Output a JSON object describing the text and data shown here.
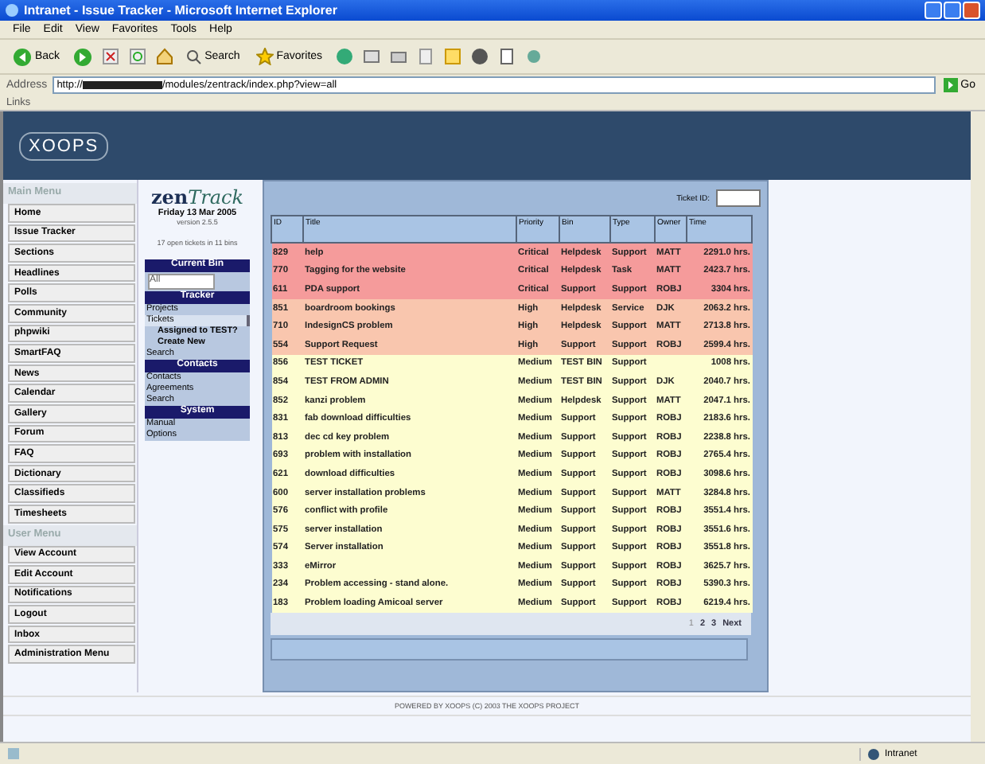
{
  "window": {
    "title": "Intranet - Issue Tracker - Microsoft Internet Explorer"
  },
  "menu_bar": [
    "File",
    "Edit",
    "View",
    "Favorites",
    "Tools",
    "Help"
  ],
  "toolbar": {
    "back": "Back",
    "search": "Search",
    "favorites": "Favorites"
  },
  "address_bar": {
    "label": "Address",
    "url_start": "http://",
    "url_end": "/modules/zentrack/index.php?view=all",
    "go": "Go"
  },
  "links_bar": "Links",
  "site_logo": "XOOPS",
  "main_menu": {
    "title": "Main Menu",
    "items": [
      "Home",
      "Issue Tracker",
      "Sections",
      "Headlines",
      "Polls",
      "Community",
      "phpwiki",
      "SmartFAQ",
      "News",
      "Calendar",
      "Gallery",
      "Forum",
      "FAQ",
      "Dictionary",
      "Classifieds",
      "Timesheets"
    ]
  },
  "user_menu": {
    "title": "User Menu",
    "items": [
      "View Account",
      "Edit Account",
      "Notifications",
      "Logout",
      "Inbox",
      "Administration Menu"
    ]
  },
  "zentrack": {
    "logo_left": "zen",
    "logo_right": "Track",
    "date": "Friday 13 Mar 2005",
    "version": "version 2.5.5",
    "summary": "17 open tickets in 11 bins",
    "sections": [
      {
        "title": "Current Bin",
        "select": "All"
      },
      {
        "title": "Tracker",
        "links": [
          {
            "label": "Projects",
            "selected": false,
            "sub": false
          },
          {
            "label": "Tickets",
            "selected": true,
            "sub": false
          },
          {
            "label": "Assigned to TEST?",
            "selected": false,
            "sub": true
          },
          {
            "label": "Create New",
            "selected": false,
            "sub": true
          },
          {
            "label": "Search",
            "selected": false,
            "sub": false
          }
        ]
      },
      {
        "title": "Contacts",
        "links": [
          {
            "label": "Contacts",
            "selected": false,
            "sub": false
          },
          {
            "label": "Agreements",
            "selected": false,
            "sub": false
          },
          {
            "label": "Search",
            "selected": false,
            "sub": false
          }
        ]
      },
      {
        "title": "System",
        "links": [
          {
            "label": "Manual",
            "selected": false,
            "sub": false
          },
          {
            "label": "Options",
            "selected": false,
            "sub": false
          }
        ]
      }
    ]
  },
  "tickets": {
    "ticket_id_label": "Ticket ID:",
    "columns": [
      "ID",
      "Title",
      "Priority",
      "Bin",
      "Type",
      "Owner",
      "Time"
    ],
    "rows": [
      {
        "id": "829",
        "title": "help",
        "priority": "Critical",
        "bin": "Helpdesk",
        "type": "Support",
        "owner": "MATT",
        "time": "2291.0 hrs.",
        "color": "#f59b9b"
      },
      {
        "id": "770",
        "title": "Tagging for the website",
        "priority": "Critical",
        "bin": "Helpdesk",
        "type": "Task",
        "owner": "MATT",
        "time": "2423.7 hrs.",
        "color": "#f59b9b"
      },
      {
        "id": "611",
        "title": "PDA support",
        "priority": "Critical",
        "bin": "Support",
        "type": "Support",
        "owner": "ROBJ",
        "time": "3304 hrs.",
        "color": "#f59b9b"
      },
      {
        "id": "851",
        "title": "boardroom bookings",
        "priority": "High",
        "bin": "Helpdesk",
        "type": "Service",
        "owner": "DJK",
        "time": "2063.2 hrs.",
        "color": "#f9c6ae"
      },
      {
        "id": "710",
        "title": "IndesignCS problem",
        "priority": "High",
        "bin": "Helpdesk",
        "type": "Support",
        "owner": "MATT",
        "time": "2713.8 hrs.",
        "color": "#f9c6ae"
      },
      {
        "id": "554",
        "title": "Support Request",
        "priority": "High",
        "bin": "Support",
        "type": "Support",
        "owner": "ROBJ",
        "time": "2599.4 hrs.",
        "color": "#f9c6ae"
      },
      {
        "id": "856",
        "title": "TEST TICKET",
        "priority": "Medium",
        "bin": "TEST BIN",
        "type": "Support",
        "owner": "",
        "time": "1008 hrs.",
        "color": "#fdfdd0"
      },
      {
        "id": "854",
        "title": "TEST FROM ADMIN",
        "priority": "Medium",
        "bin": "TEST BIN",
        "type": "Support",
        "owner": "DJK",
        "time": "2040.7 hrs.",
        "color": "#fdfdd0"
      },
      {
        "id": "852",
        "title": "kanzi problem",
        "priority": "Medium",
        "bin": "Helpdesk",
        "type": "Support",
        "owner": "MATT",
        "time": "2047.1 hrs.",
        "color": "#fdfdd0"
      },
      {
        "id": "831",
        "title": "fab download difficulties",
        "priority": "Medium",
        "bin": "Support",
        "type": "Support",
        "owner": "ROBJ",
        "time": "2183.6 hrs.",
        "color": "#fdfdd0"
      },
      {
        "id": "813",
        "title": "dec cd key problem",
        "priority": "Medium",
        "bin": "Support",
        "type": "Support",
        "owner": "ROBJ",
        "time": "2238.8 hrs.",
        "color": "#fdfdd0"
      },
      {
        "id": "693",
        "title": "problem with installation",
        "priority": "Medium",
        "bin": "Support",
        "type": "Support",
        "owner": "ROBJ",
        "time": "2765.4 hrs.",
        "color": "#fdfdd0"
      },
      {
        "id": "621",
        "title": "download difficulties",
        "priority": "Medium",
        "bin": "Support",
        "type": "Support",
        "owner": "ROBJ",
        "time": "3098.6 hrs.",
        "color": "#fdfdd0"
      },
      {
        "id": "600",
        "title": "server installation problems",
        "priority": "Medium",
        "bin": "Support",
        "type": "Support",
        "owner": "MATT",
        "time": "3284.8 hrs.",
        "color": "#fdfdd0"
      },
      {
        "id": "576",
        "title": "conflict with profile",
        "priority": "Medium",
        "bin": "Support",
        "type": "Support",
        "owner": "ROBJ",
        "time": "3551.4 hrs.",
        "color": "#fdfdd0"
      },
      {
        "id": "575",
        "title": "server installation",
        "priority": "Medium",
        "bin": "Support",
        "type": "Support",
        "owner": "ROBJ",
        "time": "3551.6 hrs.",
        "color": "#fdfdd0"
      },
      {
        "id": "574",
        "title": "Server installation",
        "priority": "Medium",
        "bin": "Support",
        "type": "Support",
        "owner": "ROBJ",
        "time": "3551.8 hrs.",
        "color": "#fdfdd0"
      },
      {
        "id": "333",
        "title": "eMirror",
        "priority": "Medium",
        "bin": "Support",
        "type": "Support",
        "owner": "ROBJ",
        "time": "3625.7 hrs.",
        "color": "#fdfdd0"
      },
      {
        "id": "234",
        "title": "Problem accessing - stand alone.",
        "priority": "Medium",
        "bin": "Support",
        "type": "Support",
        "owner": "ROBJ",
        "time": "5390.3 hrs.",
        "color": "#fdfdd0"
      },
      {
        "id": "183",
        "title": "Problem loading Amicoal server",
        "priority": "Medium",
        "bin": "Support",
        "type": "Support",
        "owner": "ROBJ",
        "time": "6219.4 hrs.",
        "color": "#fdfdd0"
      }
    ],
    "pages": [
      {
        "label": "1",
        "selected": true
      },
      {
        "label": "2",
        "selected": false
      },
      {
        "label": "3",
        "selected": false
      },
      {
        "label": "Next",
        "selected": false
      }
    ]
  },
  "footer": "POWERED BY XOOPS (C) 2003 THE XOOPS PROJECT",
  "status_bar": {
    "zone": "Intranet"
  }
}
